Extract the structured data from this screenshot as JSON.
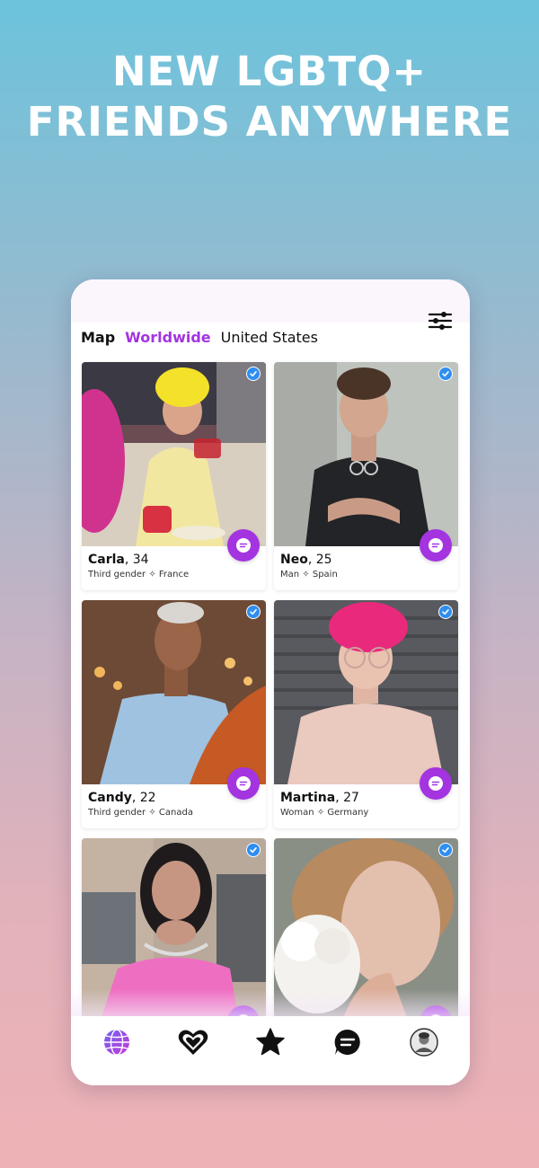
{
  "headline": {
    "line1": "NEW LGBTQ+",
    "line2": "FRIENDS ANYWHERE"
  },
  "tabs": [
    {
      "label": "Map"
    },
    {
      "label": "Worldwide",
      "active": true
    },
    {
      "label": "United States"
    }
  ],
  "colors": {
    "accent": "#a334e0",
    "verified": "#2f8ef0"
  },
  "profiles": [
    {
      "name": "Carla",
      "age": ", 34",
      "gender": "Third gender",
      "sep": " ✧ ",
      "country": "France",
      "verified": true
    },
    {
      "name": "Neo",
      "age": ", 25",
      "gender": "Man",
      "sep": " ✧ ",
      "country": "Spain",
      "verified": true
    },
    {
      "name": "Candy",
      "age": ", 22",
      "gender": "Third gender",
      "sep": " ✧ ",
      "country": "Canada",
      "verified": true
    },
    {
      "name": "Martina",
      "age": ", 27",
      "gender": "Woman",
      "sep": " ✧ ",
      "country": "Germany",
      "verified": true
    },
    {
      "verified": true
    },
    {
      "verified": true
    }
  ],
  "nav": [
    {
      "icon": "globe-icon",
      "active": true
    },
    {
      "icon": "heart-icon"
    },
    {
      "icon": "star-icon"
    },
    {
      "icon": "chat-icon"
    },
    {
      "icon": "avatar-icon"
    }
  ]
}
